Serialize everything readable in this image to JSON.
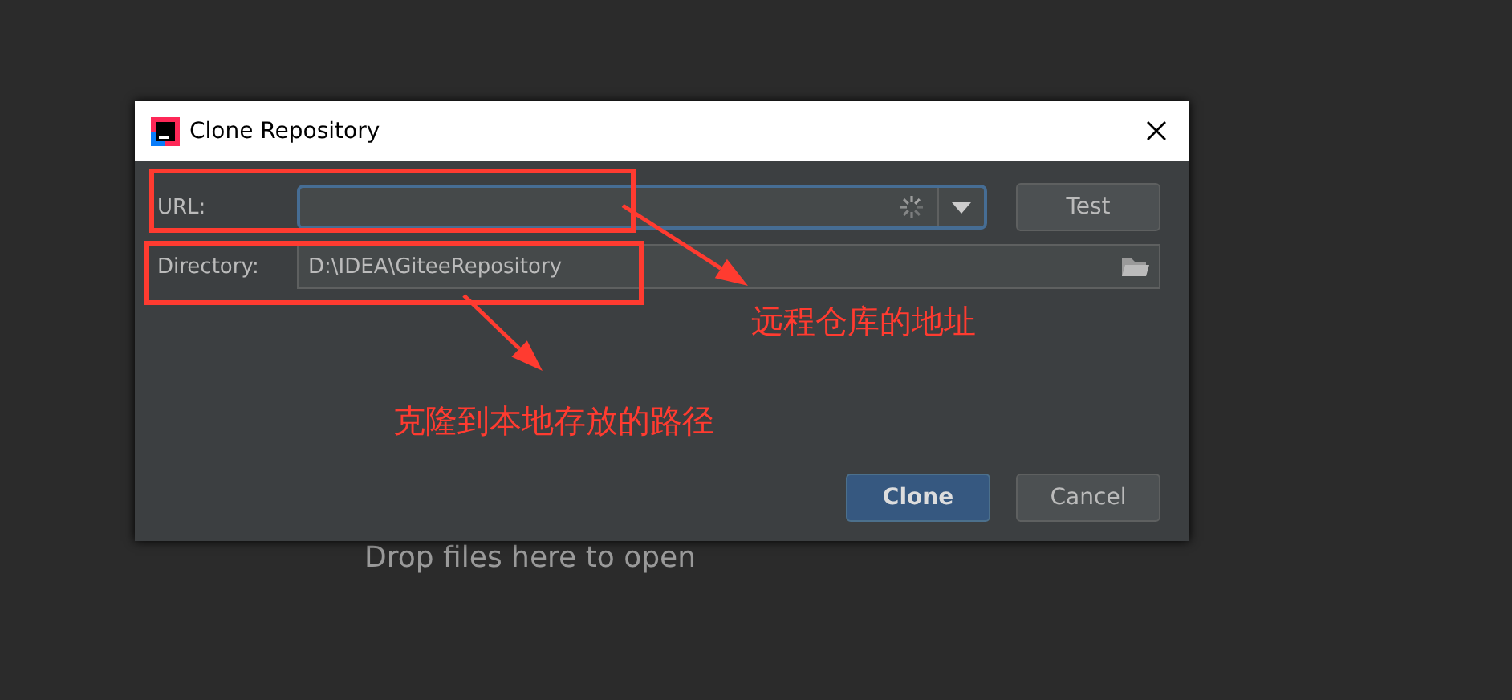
{
  "background_hint": "Drop files here to open",
  "window": {
    "title": "Clone Repository"
  },
  "fields": [
    {
      "kind": "url",
      "label": "URL:",
      "focused": true
    },
    {
      "kind": "directory",
      "label": "Directory:",
      "value": "D:\\IDEA\\GiteeRepository"
    }
  ],
  "test_button": "Test",
  "buttons": [
    {
      "label": "Clone",
      "default": true
    },
    {
      "label": "Cancel",
      "default": false
    }
  ],
  "annotations": [
    {
      "text": "远程仓库的地址"
    },
    {
      "text": "克隆到本地存放的路径"
    }
  ]
}
